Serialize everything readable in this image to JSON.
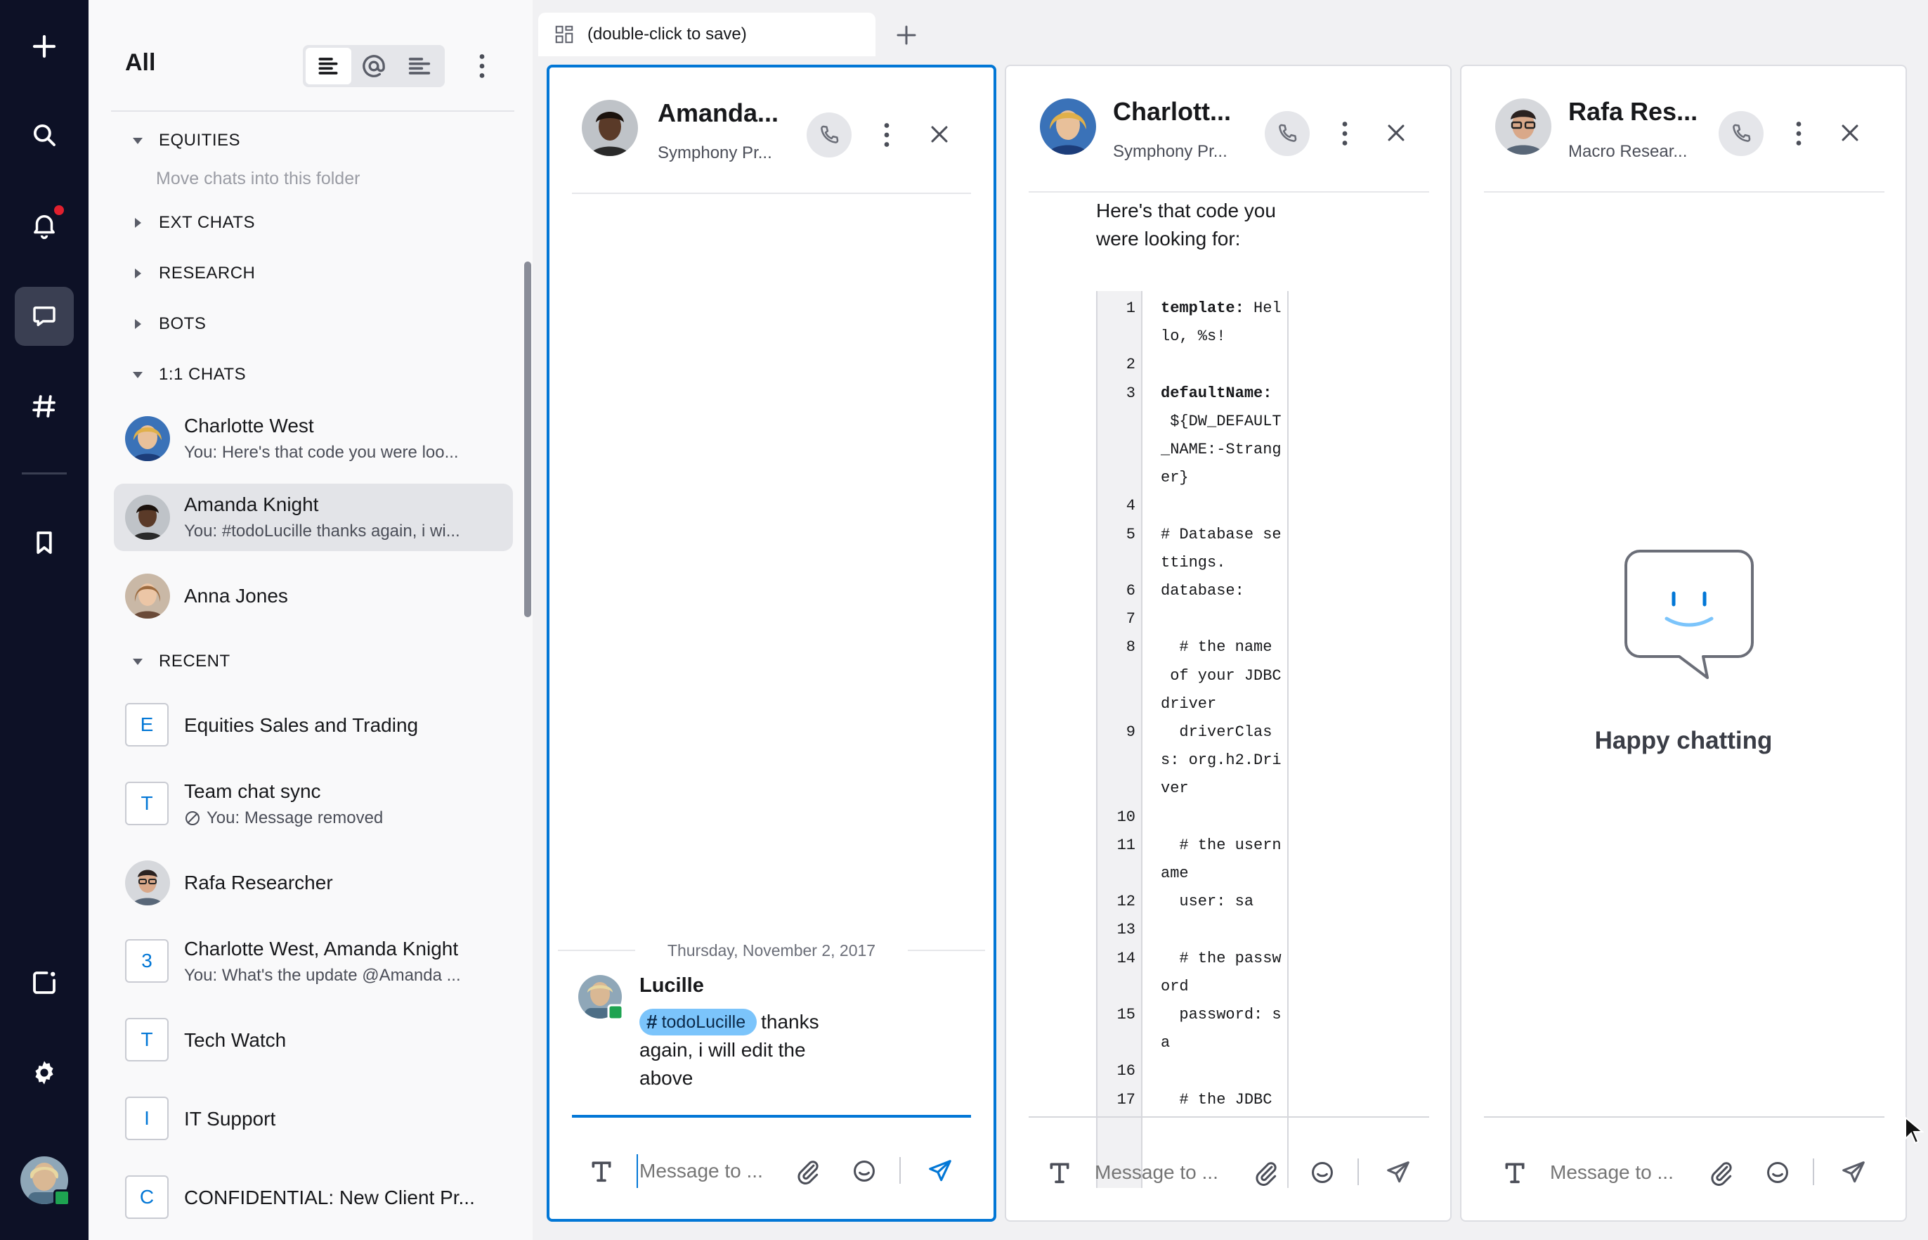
{
  "nav": {
    "title": "All",
    "folders": {
      "equities": "EQUITIES",
      "equities_hint": "Move chats into this folder",
      "ext_chats": "EXT CHATS",
      "research": "RESEARCH",
      "bots": "BOTS",
      "one_to_one": "1:1 CHATS",
      "recent": "RECENT"
    },
    "direct_chats": [
      {
        "name": "Charlotte West",
        "preview": "You: Here's that code you were loo..."
      },
      {
        "name": "Amanda Knight",
        "preview": "You: #todoLucille thanks again, i wi..."
      },
      {
        "name": "Anna Jones",
        "preview": ""
      }
    ],
    "recent_chats": [
      {
        "letter": "E",
        "name": "Equities Sales and Trading",
        "preview": ""
      },
      {
        "letter": "T",
        "name": "Team chat sync",
        "preview": "You: Message removed"
      },
      {
        "letter": "",
        "name": "Rafa Researcher",
        "preview": ""
      },
      {
        "letter": "3",
        "name": "Charlotte West, Amanda Knight",
        "preview": "You: What's the update @Amanda ..."
      },
      {
        "letter": "T",
        "name": "Tech Watch",
        "preview": ""
      },
      {
        "letter": "I",
        "name": "IT Support",
        "preview": ""
      },
      {
        "letter": "C",
        "name": "CONFIDENTIAL: New Client Pr...",
        "preview": ""
      }
    ]
  },
  "workspace": {
    "tab_label": "(double-click to save)"
  },
  "panels": [
    {
      "name": "Amanda...",
      "subtitle": "Symphony Pr...",
      "composer_placeholder": "Message to ...",
      "date_separator": "Thursday, November 2, 2017",
      "message": {
        "author": "Lucille",
        "hashtag": "todoLucille",
        "text": "thanks again, i will edit the above"
      }
    },
    {
      "name": "Charlott...",
      "subtitle": "Symphony Pr...",
      "composer_placeholder": "Message to ...",
      "intro": "Here's that code you were looking for:",
      "code": [
        {
          "n": "1",
          "t": "<b>template:</b> Hel"
        },
        {
          "n": "",
          "t": "lo, %s!"
        },
        {
          "n": "2",
          "t": ""
        },
        {
          "n": "3",
          "t": "<b>defaultName:</b>"
        },
        {
          "n": "",
          "t": " ${DW_DEFAULT"
        },
        {
          "n": "",
          "t": "_NAME:-Strang"
        },
        {
          "n": "",
          "t": "er}"
        },
        {
          "n": "4",
          "t": ""
        },
        {
          "n": "5",
          "t": "# Database se"
        },
        {
          "n": "",
          "t": "ttings."
        },
        {
          "n": "6",
          "t": "database:"
        },
        {
          "n": "7",
          "t": ""
        },
        {
          "n": "8",
          "t": "  # the name"
        },
        {
          "n": "",
          "t": " of your JDBC"
        },
        {
          "n": "",
          "t": "driver"
        },
        {
          "n": "9",
          "t": "  driverClas"
        },
        {
          "n": "",
          "t": "s: org.h2.Dri"
        },
        {
          "n": "",
          "t": "ver"
        },
        {
          "n": "10",
          "t": ""
        },
        {
          "n": "11",
          "t": "  # the usern"
        },
        {
          "n": "",
          "t": "ame"
        },
        {
          "n": "12",
          "t": "  user: sa"
        },
        {
          "n": "13",
          "t": ""
        },
        {
          "n": "14",
          "t": "  # the passw"
        },
        {
          "n": "",
          "t": "ord"
        },
        {
          "n": "15",
          "t": "  password: s"
        },
        {
          "n": "",
          "t": "a"
        },
        {
          "n": "16",
          "t": ""
        },
        {
          "n": "17",
          "t": "  # the JDBC"
        }
      ]
    },
    {
      "name": "Rafa Res...",
      "subtitle": "Macro Resear...",
      "composer_placeholder": "Message to ...",
      "empty_title": "Happy chatting"
    }
  ],
  "colors": {
    "rail_bg": "#0d1126",
    "accent": "#0277d6",
    "hashtag_bg": "#7bc4fb",
    "notification": "#e0202e",
    "presence": "#1ea351"
  }
}
